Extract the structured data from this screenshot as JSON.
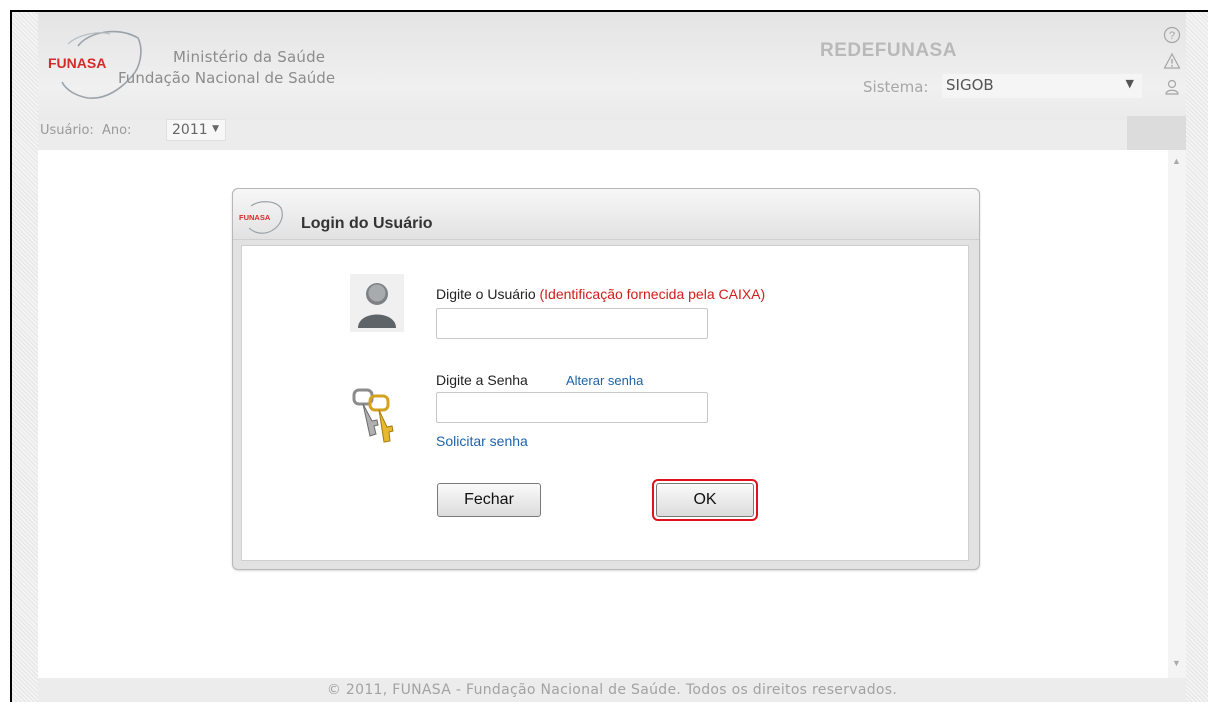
{
  "header": {
    "logo_text": "FUNASA",
    "ministry": "Ministério da Saúde",
    "foundation": "Fundação Nacional de Saúde",
    "network_name": "REDEFUNASA",
    "sistema_label": "Sistema:",
    "sistema_value": "SIGOB",
    "user_label": "Usuário:",
    "year_label": "Ano:",
    "year_value": "2011"
  },
  "dialog": {
    "logo_text": "FUNASA",
    "title": "Login do Usuário",
    "user_label": "Digite o Usuário",
    "user_hint": "(Identificação fornecida pela CAIXA)",
    "user_value": "",
    "password_label": "Digite a Senha",
    "change_password_link": "Alterar senha",
    "password_value": "",
    "request_password_link": "Solicitar senha",
    "close_button": "Fechar",
    "ok_button": "OK"
  },
  "footer": {
    "text": "© 2011, FUNASA - Fundação Nacional de Saúde. Todos os direitos reservados."
  },
  "colors": {
    "logo_red": "#d62a2a",
    "hint_red": "#d21b1b",
    "link_blue": "#1d63a8",
    "highlight": "#e0111e"
  },
  "icons": [
    "help-icon",
    "warning-icon",
    "user-outline-icon",
    "user-avatar-icon",
    "keys-icon"
  ]
}
